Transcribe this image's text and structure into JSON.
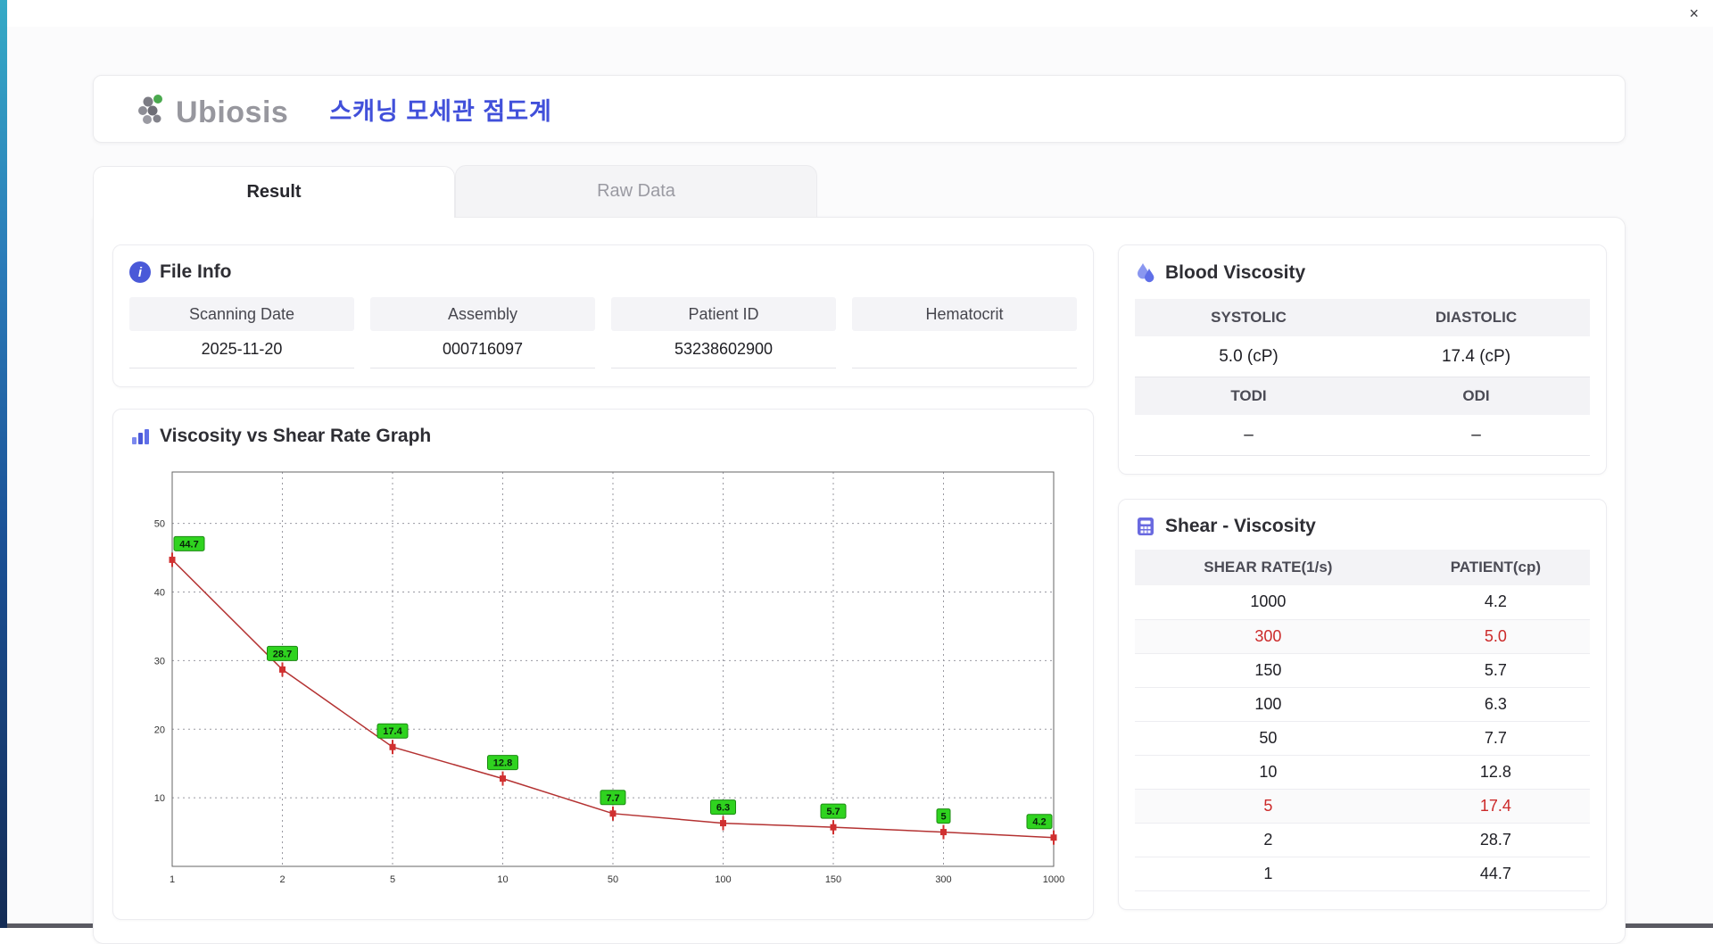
{
  "window": {
    "close_label": "×"
  },
  "header": {
    "logo_text": "Ubiosis",
    "title": "스캐닝 모세관 점도계"
  },
  "tabs": [
    {
      "label": "Result"
    },
    {
      "label": "Raw Data"
    }
  ],
  "file_info": {
    "title": "File Info",
    "fields": [
      {
        "label": "Scanning Date",
        "value": "2025-11-20"
      },
      {
        "label": "Assembly",
        "value": "000716097"
      },
      {
        "label": "Patient ID",
        "value": "53238602900"
      },
      {
        "label": "Hematocrit",
        "value": ""
      }
    ]
  },
  "graph": {
    "title": "Viscosity vs Shear Rate Graph"
  },
  "blood_viscosity": {
    "title": "Blood Viscosity",
    "rows": [
      {
        "headers": [
          "SYSTOLIC",
          "DIASTOLIC"
        ],
        "values": [
          "5.0 (cP)",
          "17.4 (cP)"
        ]
      },
      {
        "headers": [
          "TODI",
          "ODI"
        ],
        "values": [
          "–",
          "–"
        ]
      }
    ]
  },
  "shear_viscosity": {
    "title": "Shear - Viscosity",
    "columns": [
      "SHEAR RATE(1/s)",
      "PATIENT(cp)"
    ],
    "rows": [
      {
        "shear": "1000",
        "patient": "4.2"
      },
      {
        "shear": "300",
        "patient": "5.0"
      },
      {
        "shear": "150",
        "patient": "5.7"
      },
      {
        "shear": "100",
        "patient": "6.3"
      },
      {
        "shear": "50",
        "patient": "7.7"
      },
      {
        "shear": "10",
        "patient": "12.8"
      },
      {
        "shear": "5",
        "patient": "17.4"
      },
      {
        "shear": "2",
        "patient": "28.7"
      },
      {
        "shear": "1",
        "patient": "44.7"
      }
    ]
  },
  "chart_data": {
    "type": "line",
    "title": "Viscosity vs Shear Rate Graph",
    "x": [
      1,
      2,
      5,
      10,
      50,
      100,
      150,
      300,
      1000
    ],
    "values": [
      44.7,
      28.7,
      17.4,
      12.8,
      7.7,
      6.3,
      5.7,
      5,
      4.2
    ],
    "x_ticks": [
      "1",
      "2",
      "5",
      "10",
      "50",
      "100",
      "150",
      "300",
      "1000"
    ],
    "y_ticks": [
      10,
      20,
      30,
      40,
      50
    ],
    "ylim": [
      0,
      57.5
    ],
    "x_scale": "category",
    "grid": true,
    "legend": "none",
    "line_color": "#b43232",
    "marker_color": "#d03030",
    "label_bg": "#2fd31f"
  }
}
